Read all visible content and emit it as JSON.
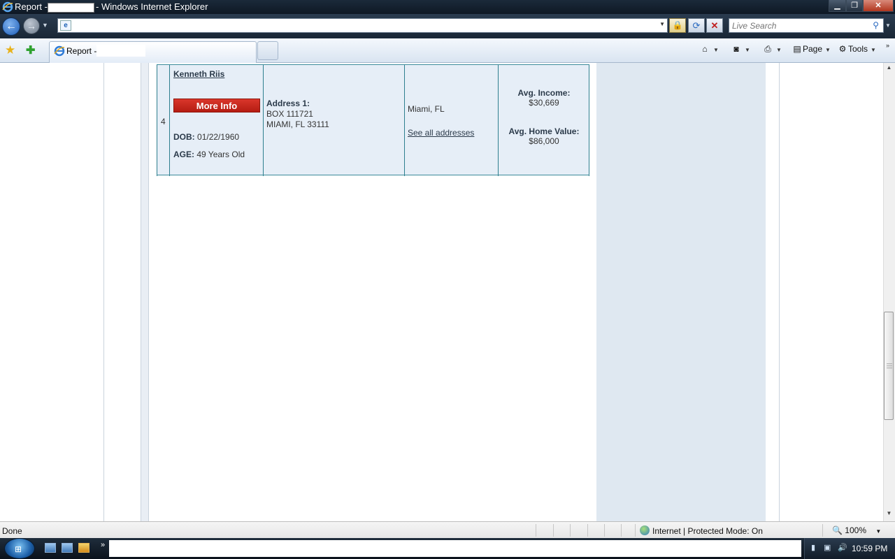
{
  "window": {
    "title_prefix": "Report -",
    "title_suffix": "- Windows Internet Explorer",
    "min_glyph": "▁",
    "max_glyph": "❐",
    "close_glyph": "✕"
  },
  "navigation": {
    "back_glyph": "←",
    "forward_glyph": "→",
    "address_value": "",
    "search_placeholder": "Live Search"
  },
  "tabs": {
    "active_label": "Report -"
  },
  "commands": {
    "page_label": "Page",
    "tools_label": "Tools"
  },
  "result": {
    "index": "4",
    "name": "Kenneth Riis",
    "more_info_label": "More Info",
    "dob_label": "DOB:",
    "dob_value": "01/22/1960",
    "age_label": "AGE:",
    "age_value": "49 Years Old",
    "address_label": "Address 1:",
    "address_line1": "BOX 111721",
    "address_line2": "MIAMI, FL 33111",
    "city_state": "Miami, FL",
    "see_all_label": "See all addresses",
    "avg_income_label": "Avg. Income:",
    "avg_income_value": "$30,669",
    "avg_home_label": "Avg. Home Value:",
    "avg_home_value": "$86,000"
  },
  "statusbar": {
    "status": "Done",
    "zone": "Internet | Protected Mode: On",
    "zoom": "100%"
  },
  "taskbar": {
    "clock": "10:59 PM"
  },
  "colors": {
    "more_info_button": "#c8261b",
    "result_background": "#e6eef7",
    "right_panel": "#dfe8f1"
  }
}
